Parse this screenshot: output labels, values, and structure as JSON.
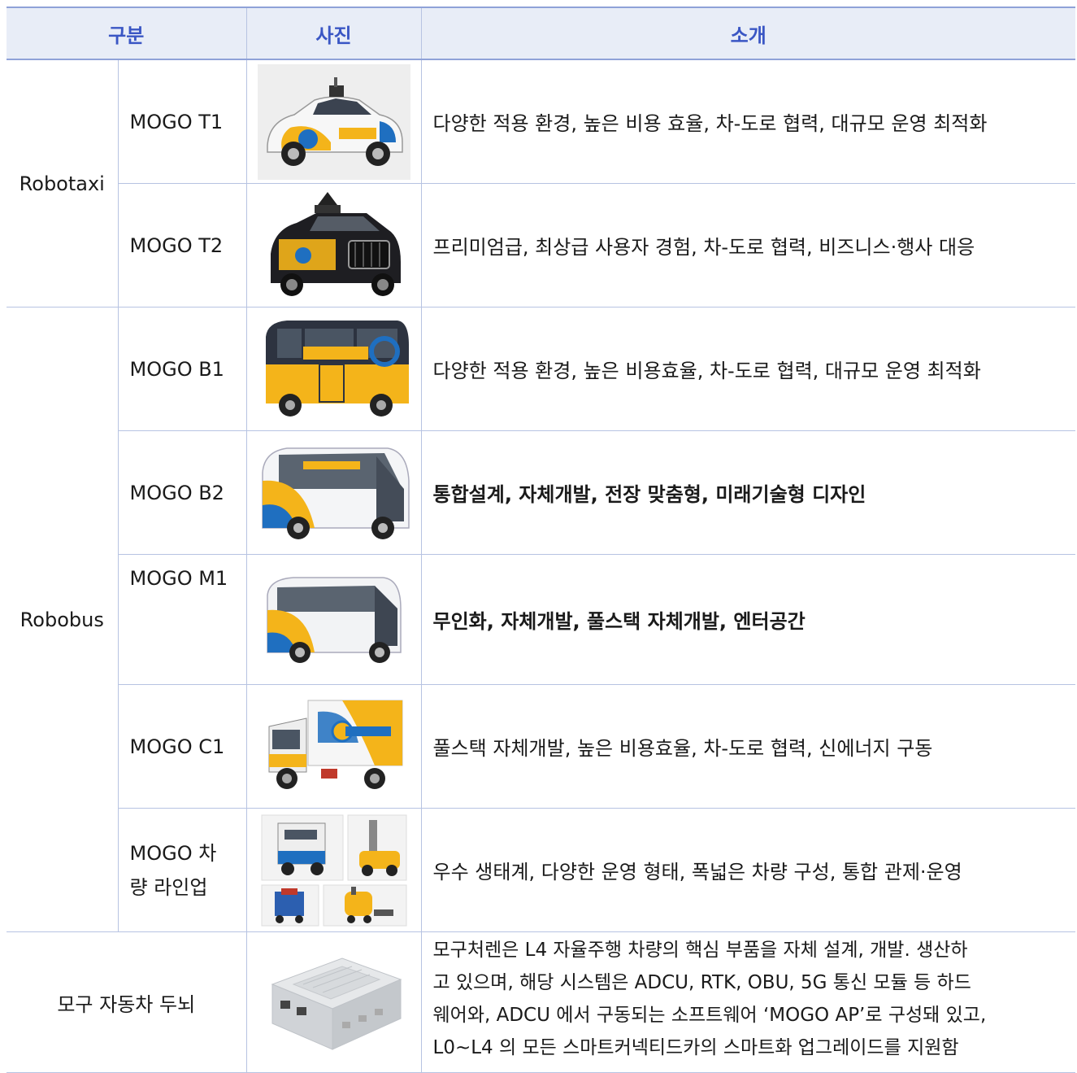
{
  "header": {
    "category": "구분",
    "photo": "사진",
    "intro": "소개"
  },
  "groups": {
    "robotaxi": "Robotaxi",
    "robobus": "Robobus"
  },
  "rows": [
    {
      "model": "MOGO T1",
      "desc": "다양한 적용 환경, 높은 비용 효율, 차-도로 협력, 대규모 운영 최적화",
      "photo_icon": "white-sedan-robotaxi-icon"
    },
    {
      "model": "MOGO T2",
      "desc": "프리미엄급, 최상급 사용자 경험, 차-도로 협력, 비즈니스·행사 대응",
      "photo_icon": "black-suv-robotaxi-icon"
    },
    {
      "model": "MOGO B1",
      "desc": "다양한 적용 환경, 높은 비용효율, 차-도로 협력, 대규모 운영 최적화",
      "photo_icon": "yellow-minibus-icon"
    },
    {
      "model": "MOGO B2",
      "desc": "통합설계, 자체개발, 전장 맞춤형, 미래기술형 디자인",
      "photo_icon": "white-shuttle-bus-icon"
    },
    {
      "model": "MOGO M1",
      "desc": "무인화, 자체개발, 풀스택 자체개발, 엔터공간",
      "photo_icon": "compact-shuttle-icon"
    },
    {
      "model": "MOGO C1",
      "desc": "풀스택 자체개발, 높은 비용효율, 차-도로 협력, 신에너지 구동",
      "photo_icon": "street-sweeper-truck-icon"
    },
    {
      "model_line1": "MOGO 차",
      "model_line2": "량 라인업",
      "desc": "우수 생태계, 다양한 운영 형태, 폭넓은 차량 구성, 통합 관제·운영",
      "photo_icon": "vehicle-lineup-collage-icon"
    }
  ],
  "brain": {
    "label": "모구 자동차 두뇌",
    "desc_lines": [
      "모구처렌은 L4 자율주행 차량의 핵심 부품을 자체 설계, 개발. 생산하",
      "고 있으며, 해당 시스템은 ADCU, RTK, OBU, 5G 통신 모듈 등 하드",
      "웨어와, ADCU 에서 구동되는 소프트웨어 ‘MOGO AP’로 구성돼 있고,",
      "L0~L4 의 모든 스마트커넥티드카의 스마트화 업그레이드를 지원함"
    ],
    "photo_icon": "computing-unit-box-icon"
  },
  "colors": {
    "header_text": "#3a56c4",
    "header_bg": "#e8edf7",
    "border": "#b7c3e2",
    "brand_yellow": "#f4b41a",
    "brand_blue": "#1f6fc0"
  }
}
